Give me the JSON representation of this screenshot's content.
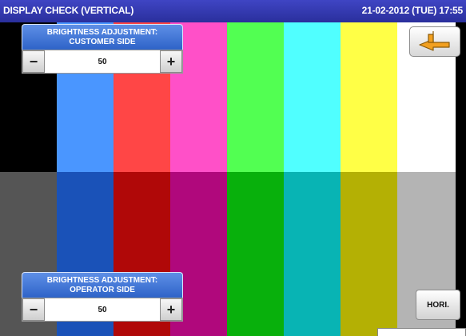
{
  "window": {
    "title": "DISPLAY CHECK (VERTICAL)",
    "datetime": "21-02-2012 (TUE)  17:55"
  },
  "color_bars": [
    {
      "top": "#000000",
      "bottom": "#555555"
    },
    {
      "top": "#4a96ff",
      "bottom": "#1a52b8"
    },
    {
      "top": "#ff4646",
      "bottom": "#b00808"
    },
    {
      "top": "#ff50c8",
      "bottom": "#b0087c"
    },
    {
      "top": "#52ff52",
      "bottom": "#08b00c"
    },
    {
      "top": "#50ffff",
      "bottom": "#08b4b4"
    },
    {
      "top": "#ffff46",
      "bottom": "#b4b004"
    },
    {
      "top": "#ffffff",
      "bottom": "#b4b4b4"
    }
  ],
  "customer_brightness": {
    "title_line1": "BRIGHTNESS ADJUSTMENT:",
    "title_line2": "CUSTOMER SIDE",
    "minus_label": "−",
    "value": "50",
    "plus_label": "+"
  },
  "operator_brightness": {
    "title_line1": "BRIGHTNESS ADJUSTMENT:",
    "title_line2": "OPERATOR SIDE",
    "minus_label": "−",
    "value": "50",
    "plus_label": "+"
  },
  "buttons": {
    "back_icon": "return-arrow-icon",
    "hori_label": "HORI."
  },
  "colors": {
    "title_bar": "#2f35a8",
    "panel_header": "#3d70d4",
    "back_arrow": "#f2a020"
  }
}
